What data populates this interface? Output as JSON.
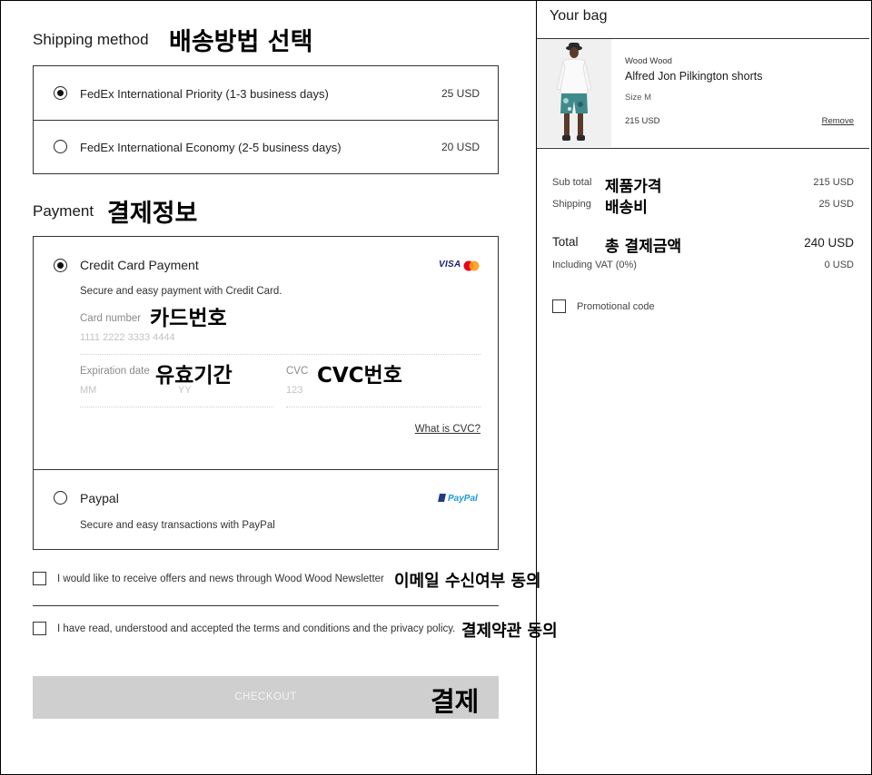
{
  "shipping": {
    "title": "Shipping method",
    "annotation": "배송방법 선택",
    "options": [
      {
        "label": "FedEx International Priority (1-3 business days)",
        "price": "25 USD",
        "selected": true
      },
      {
        "label": "FedEx International Economy (2-5 business days)",
        "price": "20 USD",
        "selected": false
      }
    ]
  },
  "payment": {
    "title": "Payment",
    "annotation": "결제정보",
    "credit": {
      "label": "Credit Card Payment",
      "description": "Secure and easy payment with Credit Card.",
      "card_number_label": "Card number",
      "card_number_annotation": "카드번호",
      "card_number_placeholder": "1111 2222 3333 4444",
      "expiration_label": "Expiration date",
      "expiration_annotation": "유효기간",
      "month_placeholder": "MM",
      "year_placeholder": "YY",
      "cvc_label": "CVC",
      "cvc_annotation": "CVC번호",
      "cvc_placeholder": "123",
      "cvc_help_link": "What is CVC?",
      "visa_text": "VISA"
    },
    "paypal": {
      "label": "Paypal",
      "description": "Secure and easy transactions with PayPal",
      "logo_text": "PayPal"
    }
  },
  "consents": {
    "newsletter": "I would like to receive offers and news through Wood Wood Newsletter",
    "newsletter_annotation": "이메일 수신여부 동의",
    "terms": "I have read, understood and accepted the terms and conditions and the privacy policy.",
    "terms_annotation": "결제약관 동의"
  },
  "checkout": {
    "label": "CHECKOUT",
    "annotation": "결제"
  },
  "bag": {
    "title": "Your bag",
    "item": {
      "brand": "Wood Wood",
      "name": "Alfred Jon Pilkington shorts",
      "size": "Size M",
      "price": "215 USD",
      "remove": "Remove"
    },
    "subtotal_label": "Sub total",
    "subtotal_annotation": "제품가격",
    "subtotal_value": "215 USD",
    "shipping_label": "Shipping",
    "shipping_annotation": "배송비",
    "shipping_value": "25 USD",
    "total_label": "Total",
    "total_annotation": "총 결제금액",
    "total_value": "240 USD",
    "vat_label": "Including VAT (0%)",
    "vat_value": "0 USD",
    "promo_label": "Promotional code"
  },
  "colors": {
    "checkout_bg": "#cfcfcf",
    "checkout_text": "#f4f4f4",
    "visa_blue": "#1a1f71",
    "mastercard_red": "#eb001b",
    "mastercard_orange": "#f79e1b",
    "paypal_dark": "#253b80",
    "paypal_light": "#179bd7"
  }
}
